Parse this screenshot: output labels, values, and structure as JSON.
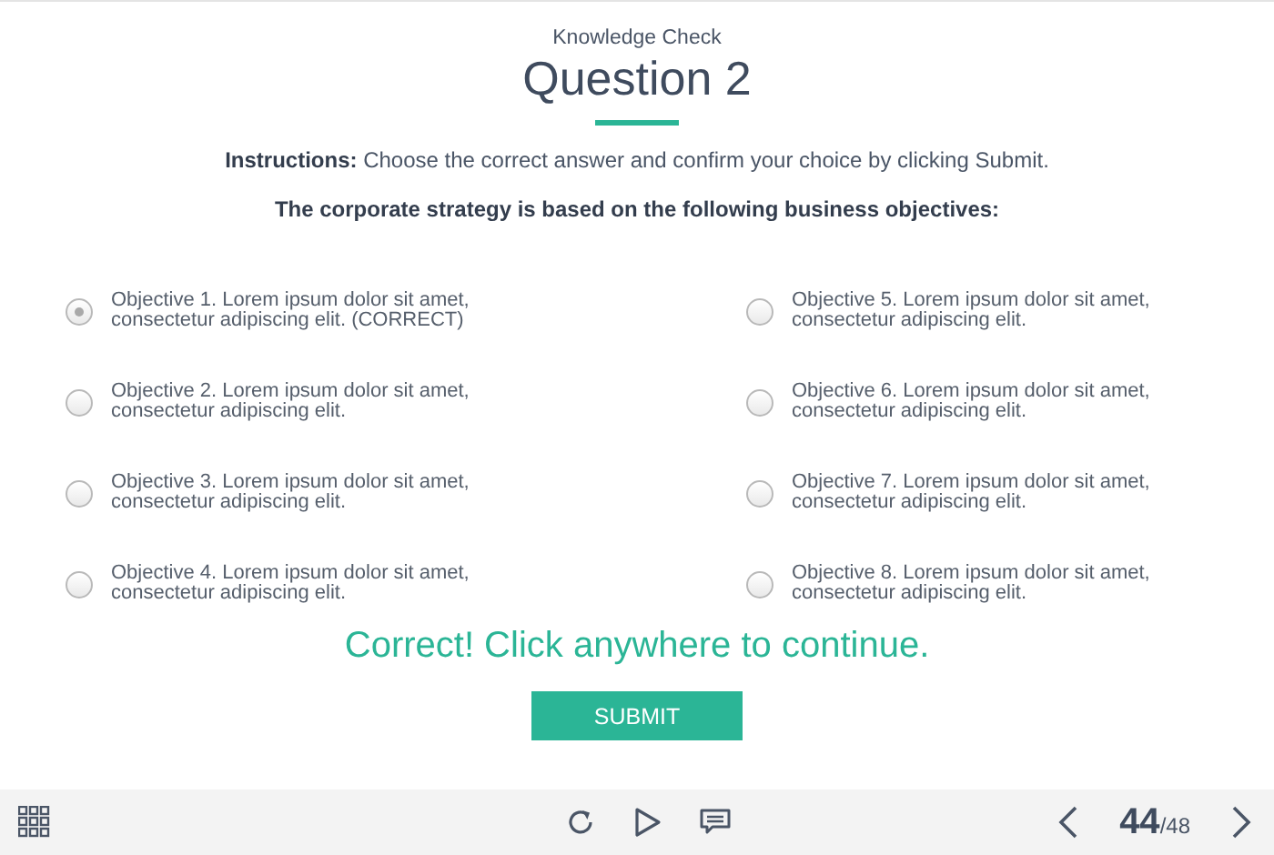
{
  "header": {
    "subtitle": "Knowledge Check",
    "title": "Question 2"
  },
  "instructions": "**Instructions:** Choose the correct answer and confirm your choice by clicking Submit.",
  "question": "The corporate strategy is based on the following business objectives:",
  "options": [
    {
      "text": "Objective 1. Lorem ipsum dolor sit amet, consectetur adipiscing elit. (CORRECT)",
      "selected": true
    },
    {
      "text": "Objective 2. Lorem ipsum dolor sit amet, consectetur adipiscing elit.",
      "selected": false
    },
    {
      "text": "Objective 3. Lorem ipsum dolor sit amet, consectetur adipiscing elit.",
      "selected": false
    },
    {
      "text": "Objective 4. Lorem ipsum dolor sit amet, consectetur adipiscing elit.",
      "selected": false
    },
    {
      "text": "Objective 5. Lorem ipsum dolor sit amet, consectetur adipiscing elit.",
      "selected": false
    },
    {
      "text": "Objective 6. Lorem ipsum dolor sit amet, consectetur adipiscing elit.",
      "selected": false
    },
    {
      "text": "Objective 7. Lorem ipsum dolor sit amet, consectetur adipiscing elit.",
      "selected": false
    },
    {
      "text": "Objective 8. Lorem ipsum dolor sit amet, consectetur adipiscing elit.",
      "selected": false
    }
  ],
  "feedback": "Correct! Click anywhere to continue.",
  "submit": "SUBMIT",
  "player": {
    "current": "44",
    "total": "/48"
  }
}
